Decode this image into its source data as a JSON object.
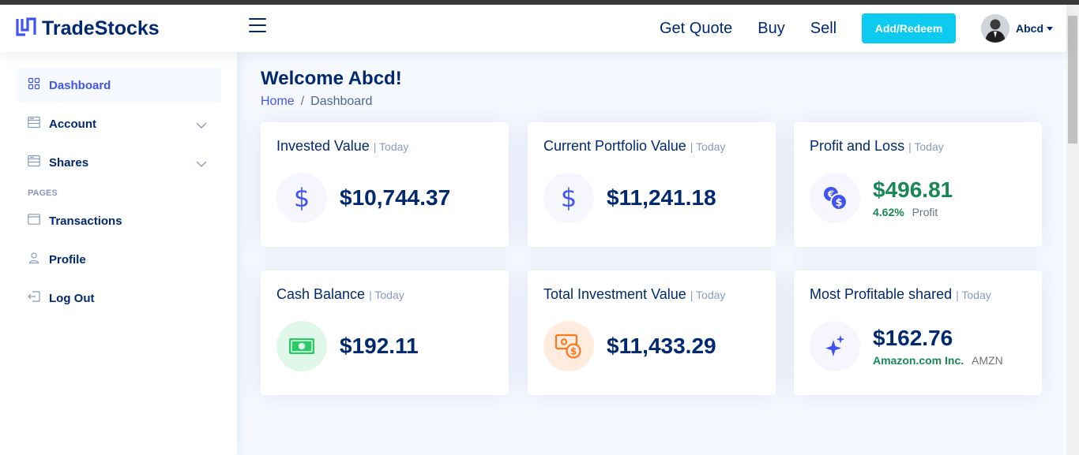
{
  "brand": {
    "name": "TradeStocks"
  },
  "header": {
    "nav": [
      {
        "label": "Get Quote"
      },
      {
        "label": "Buy"
      },
      {
        "label": "Sell"
      }
    ],
    "add_button": "Add/Redeem",
    "user_name": "Abcd"
  },
  "sidebar": {
    "items": [
      {
        "label": "Dashboard",
        "icon": "grid-icon",
        "active": true
      },
      {
        "label": "Account",
        "icon": "menu-list-icon",
        "expandable": true
      },
      {
        "label": "Shares",
        "icon": "menu-list-icon",
        "expandable": true
      }
    ],
    "section_heading": "PAGES",
    "pages": [
      {
        "label": "Transactions",
        "icon": "window-icon"
      },
      {
        "label": "Profile",
        "icon": "person-icon"
      },
      {
        "label": "Log Out",
        "icon": "logout-icon"
      }
    ]
  },
  "page": {
    "title": "Welcome Abcd!",
    "breadcrumb": {
      "home": "Home",
      "separator": "/",
      "current": "Dashboard"
    }
  },
  "cards": [
    {
      "title": "Invested Value",
      "subtitle": "| Today",
      "value": "$10,744.37",
      "icon": "dollar-icon",
      "icon_bg": "#f6f6fe",
      "icon_color": "#4154f1"
    },
    {
      "title": "Current Portfolio Value",
      "subtitle": "| Today",
      "value": "$11,241.18",
      "icon": "dollar-icon",
      "icon_bg": "#f6f6fe",
      "icon_color": "#4154f1"
    },
    {
      "title": "Profit and Loss",
      "subtitle": "| Today",
      "value": "$496.81",
      "percent": "4.62%",
      "note": "Profit",
      "icon": "currency-exchange-icon",
      "icon_bg": "#f6f6fe",
      "icon_color": "#4154f1"
    },
    {
      "title": "Cash Balance",
      "subtitle": "| Today",
      "value": "$192.11",
      "icon": "cash-icon",
      "icon_bg": "#e0f8e9",
      "icon_color": "#2eca6a"
    },
    {
      "title": "Total Investment Value",
      "subtitle": "| Today",
      "value": "$11,433.29",
      "icon": "cash-coin-icon",
      "icon_bg": "#ffecdf",
      "icon_color": "#ff771d"
    },
    {
      "title": "Most Profitable shared",
      "subtitle": "| Today",
      "value": "$162.76",
      "company": "Amazon.com Inc.",
      "ticker": "AMZN",
      "icon": "sparkles-icon",
      "icon_bg": "#f6f6fe",
      "icon_color": "#4154f1"
    }
  ],
  "colors": {
    "primary": "#4154f1",
    "navy": "#012970",
    "accent_button": "#0dcaf0",
    "profit_green": "#198754"
  }
}
